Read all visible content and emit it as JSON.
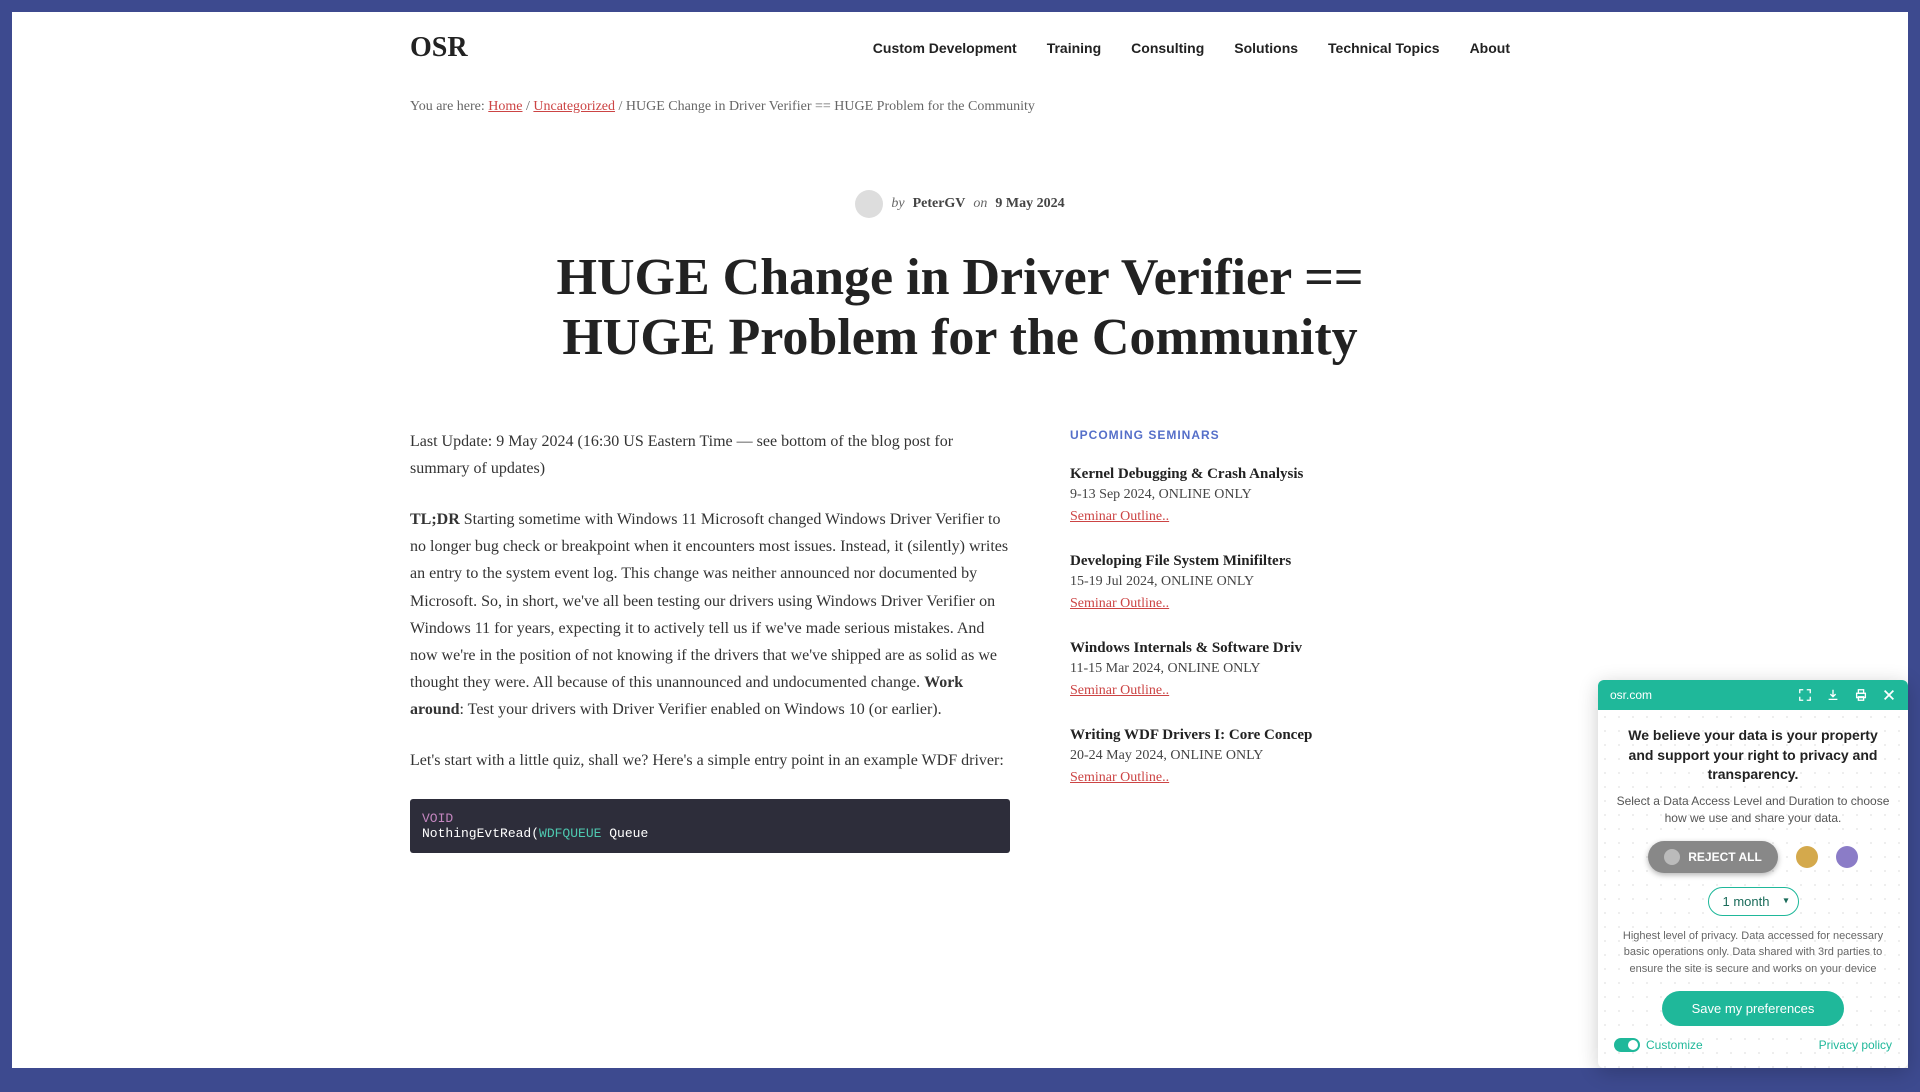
{
  "site": {
    "name": "OSR"
  },
  "nav": [
    "Custom Development",
    "Training",
    "Consulting",
    "Solutions",
    "Technical Topics",
    "About"
  ],
  "breadcrumb": {
    "prefix": "You are here: ",
    "home": "Home",
    "category": "Uncategorized",
    "current": "HUGE Change in Driver Verifier == HUGE Problem for the Community"
  },
  "meta": {
    "by": "by",
    "author": "PeterGV",
    "on": "on",
    "date": "9 May 2024"
  },
  "title": "HUGE Change in Driver Verifier == HUGE Problem for the Community",
  "article": {
    "p1": "Last Update: 9 May 2024 (16:30 US Eastern Time — see bottom of the blog post for summary of updates)",
    "tldr_label": "TL;DR",
    "p2a": " Starting sometime with Windows 11 Microsoft changed Windows Driver Verifier to no longer bug check or breakpoint when it encounters most issues. Instead, it (silently) writes an entry to the system event log. This change was neither announced nor documented by Microsoft. So, in short, we've all been testing our drivers using Windows Driver Verifier on Windows 11 for years, expecting it to actively tell us if we've made serious mistakes. And now we're in the position of not knowing if the drivers that we've shipped are as solid as we thought they were. All because of this unannounced and undocumented change. ",
    "workaround_label": "Work around",
    "p2b": ": Test your drivers with Driver Verifier enabled on Windows 10 (or earlier).",
    "p3": "Let's start with a little quiz, shall we? Here's a simple entry point in an example WDF driver:",
    "code": {
      "l1a": "VOID",
      "l2a": "NothingEvtRead(",
      "l2b": "WDFQUEUE",
      "l2c": "        Queue"
    }
  },
  "sidebar": {
    "heading": "UPCOMING SEMINARS",
    "link_text": "Seminar Outline..",
    "seminars": [
      {
        "title": "Kernel Debugging & Crash Analysis",
        "date": "9-13 Sep 2024, ONLINE ONLY"
      },
      {
        "title": "Developing File System Minifilters",
        "date": "15-19 Jul 2024, ONLINE ONLY"
      },
      {
        "title": "Windows Internals & Software Driv",
        "date": "11-15 Mar 2024, ONLINE ONLY"
      },
      {
        "title": "Writing WDF Drivers I: Core Concep",
        "date": "20-24 May 2024, ONLINE ONLY"
      }
    ]
  },
  "privacy": {
    "domain": "osr.com",
    "title": "We believe your data is your property and support your right to privacy and transparency.",
    "subtitle": "Select a Data Access Level and Duration to choose how we use and share your data.",
    "reject": "REJECT ALL",
    "duration": "1 month",
    "desc": "Highest level of privacy. Data accessed for necessary basic operations only. Data shared with 3rd parties to ensure the site is secure and works on your device",
    "save": "Save my preferences",
    "customize": "Customize",
    "policy": "Privacy policy"
  }
}
